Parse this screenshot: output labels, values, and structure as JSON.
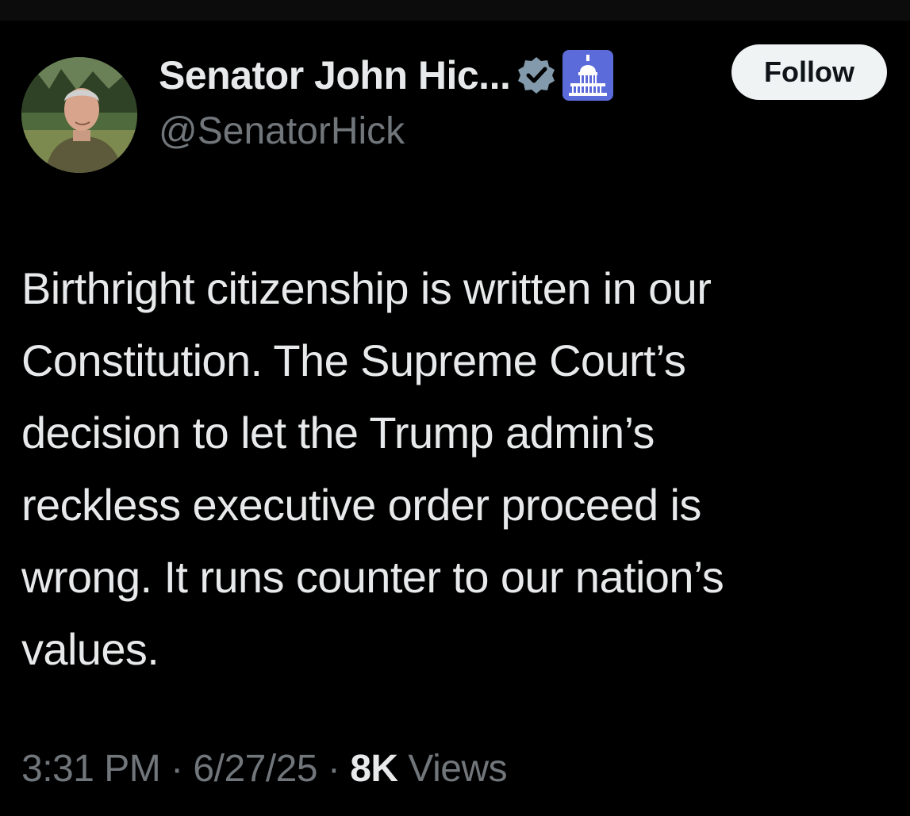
{
  "author": {
    "display_name": "Senator John Hic...",
    "handle": "@SenatorHick",
    "verified_badge_icon": "verified-badge-icon",
    "affiliation_badge_icon": "capitol-building-icon",
    "badge_color": "#829aab",
    "gov_badge_color": "#5b6bd9"
  },
  "follow_button": {
    "label": "Follow"
  },
  "tweet": {
    "lines": [
      "Birthright citizenship is written in our",
      "Constitution. The Supreme Court’s",
      "decision to let the Trump admin’s",
      "reckless executive order proceed is",
      "wrong. It runs counter to our nation’s",
      "values."
    ]
  },
  "meta": {
    "time": "3:31 PM",
    "separator": " · ",
    "date": "6/27/25",
    "views_count": "8K",
    "views_label": " Views"
  }
}
